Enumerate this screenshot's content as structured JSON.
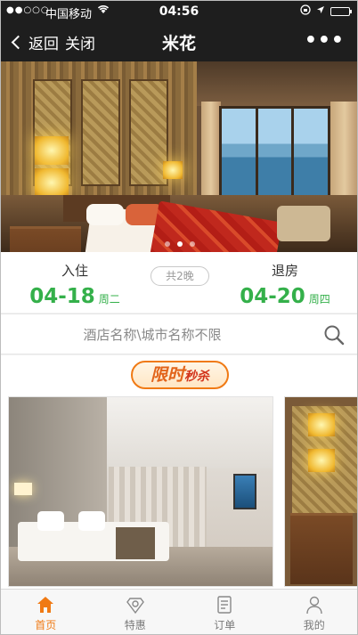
{
  "status_bar": {
    "signal": "●●○○○",
    "carrier": "中国移动",
    "time": "04:56",
    "battery_level": 0.8
  },
  "nav": {
    "back_label": "返回",
    "close_label": "关闭",
    "title": "米花",
    "more_label": "•••"
  },
  "hero": {
    "slide_count": 3,
    "active_slide": 1
  },
  "booking": {
    "checkin_label": "入住",
    "checkin_date": "04-18",
    "checkin_weekday": "周二",
    "nights_label": "共2晚",
    "checkout_label": "退房",
    "checkout_date": "04-20",
    "checkout_weekday": "周四"
  },
  "search": {
    "placeholder": "酒店名称\\城市名称不限"
  },
  "promo": {
    "title_part1": "限时",
    "title_part2": "秒杀"
  },
  "tabs": [
    {
      "label": "首页",
      "icon": "home-icon",
      "active": true
    },
    {
      "label": "特惠",
      "icon": "discount-icon",
      "active": false
    },
    {
      "label": "订单",
      "icon": "order-icon",
      "active": false
    },
    {
      "label": "我的",
      "icon": "user-icon",
      "active": false
    }
  ],
  "colors": {
    "accent_green": "#34b04a",
    "accent_orange": "#f07a14",
    "bar_dark": "#1e1e1e"
  }
}
